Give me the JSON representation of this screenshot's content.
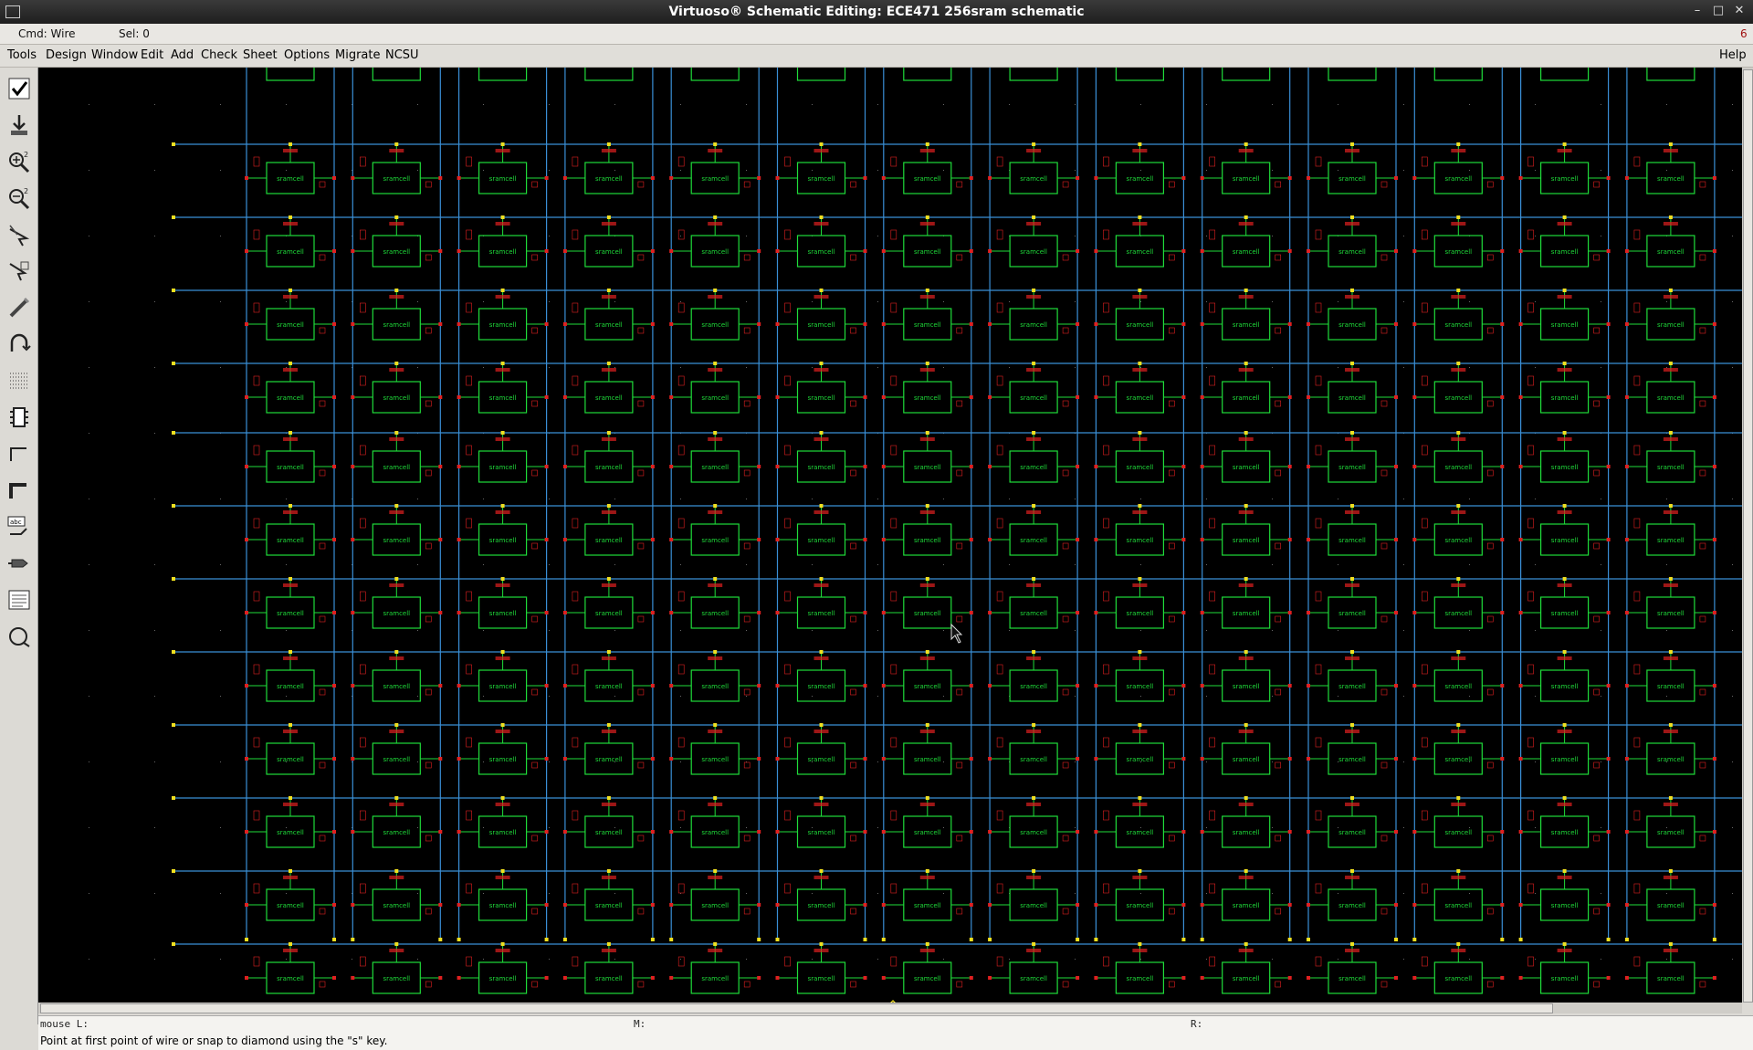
{
  "window": {
    "title": "Virtuoso® Schematic Editing: ECE471 256sram schematic",
    "controls": [
      "–",
      "□",
      "✕"
    ]
  },
  "status": {
    "cmd": "Cmd: Wire",
    "sel": "Sel: 0",
    "right_number": "6"
  },
  "menu": {
    "items": [
      "Tools",
      "Design",
      "Window",
      "Edit",
      "Add",
      "Check",
      "Sheet",
      "Options",
      "Migrate",
      "NCSU"
    ],
    "help": "Help"
  },
  "toolbar": {
    "tools": [
      {
        "name": "check-save-icon"
      },
      {
        "name": "save-icon"
      },
      {
        "name": "zoom-in-icon"
      },
      {
        "name": "zoom-out-icon"
      },
      {
        "name": "stretch-icon"
      },
      {
        "name": "copy-icon"
      },
      {
        "name": "delete-icon"
      },
      {
        "name": "undo-icon"
      },
      {
        "name": "property-icon"
      },
      {
        "name": "instance-icon"
      },
      {
        "name": "wire-narrow-icon"
      },
      {
        "name": "wire-wide-icon"
      },
      {
        "name": "wire-name-icon"
      },
      {
        "name": "pin-icon"
      },
      {
        "name": "cmd-options-icon"
      },
      {
        "name": "repeat-icon"
      }
    ]
  },
  "schematic": {
    "cell_label": "sramcell",
    "colors": {
      "background": "#000000",
      "wire": "#3a8fd6",
      "cell": "#1fdc3a",
      "pin": "#e02020",
      "node": "#f0e020"
    }
  },
  "bottom": {
    "mouse_l": "mouse L:",
    "mouse_m": "M:",
    "mouse_r": "R:",
    "prompt": "Point at first point of wire or snap to diamond using the \"s\" key."
  }
}
